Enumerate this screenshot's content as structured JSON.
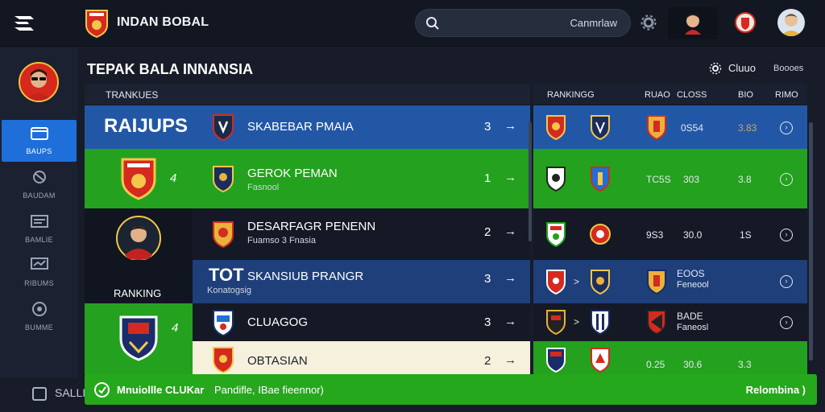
{
  "header": {
    "app_title": "INDAN BOBAL",
    "search_text": "Canmrlaw",
    "icons": [
      "menu-logo-icon",
      "club-crest-icon",
      "search-icon",
      "settings-icon",
      "profile-avatar",
      "club-crest-icon",
      "user-avatar"
    ]
  },
  "sidebar": {
    "items": [
      {
        "label": "BAUPS",
        "icon": "folder-icon",
        "active": true
      },
      {
        "label": "BAUDAM",
        "icon": "ball-icon",
        "active": false
      },
      {
        "label": "BAMLIE",
        "icon": "list-icon",
        "active": false
      },
      {
        "label": "RIBUMS",
        "icon": "screen-icon",
        "active": false
      },
      {
        "label": "BUMME",
        "icon": "target-icon",
        "active": false
      }
    ],
    "bottom_label": "SALLIC"
  },
  "page": {
    "title": "TEPAK BALA INNANSIA",
    "clubs_button": "Cluuo",
    "stat_label": "Boooes"
  },
  "left_panel": {
    "header": "TRANKUES",
    "group_label": "RANKING",
    "rows": [
      {
        "name": "SKABEBAR PMAIA",
        "sub": "",
        "num": "3",
        "tile_text": "RAIJUPS"
      },
      {
        "name": "GEROK PEMAN",
        "sub": "Fasnool",
        "num": "1",
        "tile_text": "4"
      },
      {
        "name": "DESARFAGR PENENN",
        "sub": "Fuamso 3 Fnasia",
        "num": "2",
        "tile_text": ""
      },
      {
        "name": "SKANSIUB PRANGR",
        "sub": "Konatogsig",
        "num": "3",
        "tile_text": "TOT"
      },
      {
        "name": "CLUAGOG",
        "sub": "",
        "num": "3",
        "tile_text": "4"
      },
      {
        "name": "OBTASIAN",
        "sub": "",
        "num": "2",
        "tile_text": ""
      }
    ]
  },
  "right_panel": {
    "headers": [
      "RANKINGG",
      "RUAO",
      "CLOSS",
      "BIO",
      "RIMO"
    ],
    "rows": [
      {
        "a": "0S54",
        "b": "",
        "c": "3.83",
        "chev": "",
        "sub": ""
      },
      {
        "a": "TC5S",
        "b": "303",
        "c": "3.8",
        "chev": "",
        "sub": ""
      },
      {
        "a": "9S3",
        "b": "30.0",
        "c": "1S",
        "chev": "",
        "sub": ""
      },
      {
        "a": "EOOS",
        "b": "",
        "c": "",
        "chev": ">",
        "sub": "Feneool"
      },
      {
        "a": "BADE",
        "b": "",
        "c": "",
        "chev": ">",
        "sub": "Faneosl"
      },
      {
        "a": "0.25",
        "b": "30.6",
        "c": "3.3",
        "chev": "",
        "sub": ""
      }
    ]
  },
  "banner": {
    "title": "Mnuiollle CLUKar",
    "subtitle": "Pandifle, IBae fieennor)",
    "link": "Relombina )"
  },
  "colors": {
    "background": "#171c28",
    "blue_row": "#2257a6",
    "green_row": "#24a11e",
    "dark_row": "#141925",
    "cream_row": "#f6f1dc",
    "accent_blue": "#1e6fd9"
  }
}
